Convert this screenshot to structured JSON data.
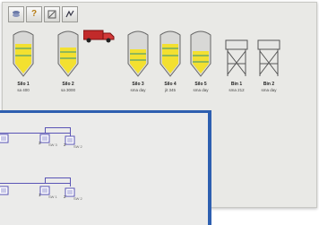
{
  "toolbar": {
    "buttons": [
      {
        "icon": "stack-icon"
      },
      {
        "icon": "help-icon",
        "glyph": "?"
      },
      {
        "icon": "settings-icon"
      },
      {
        "icon": "flow-icon"
      }
    ]
  },
  "silos": [
    {
      "name": "Silo 1",
      "value": "sa 400",
      "fill": "yellow"
    },
    {
      "name": "Silo 2",
      "value": "sa 3000",
      "fill": "yellow"
    },
    {
      "name": "Silo 3",
      "value": "sma day",
      "fill": "yellow"
    },
    {
      "name": "Silo 4",
      "value": "jit 345",
      "fill": "yellow"
    },
    {
      "name": "Silo 5",
      "value": "sma day",
      "fill": "yellow"
    },
    {
      "name": "Bin 1",
      "value": "sma 212",
      "fill": "empty"
    },
    {
      "name": "Bin 2",
      "value": "sma day",
      "fill": "empty"
    }
  ],
  "colors": {
    "accent": "#2e5fb0",
    "wire": "#5a54b6",
    "fill": "#f3e030",
    "truck": "#c22a2a"
  },
  "front": {
    "row1": [
      {
        "label": "2",
        "sub": ""
      },
      {
        "label": "3",
        "sub": "SW 3"
      },
      {
        "label": "2",
        "sub": "SW 2"
      }
    ],
    "row2": [
      {
        "label": "3",
        "sub": ""
      },
      {
        "label": "1",
        "sub": "SW 1"
      },
      {
        "label": "2",
        "sub": "SW 2"
      }
    ]
  }
}
